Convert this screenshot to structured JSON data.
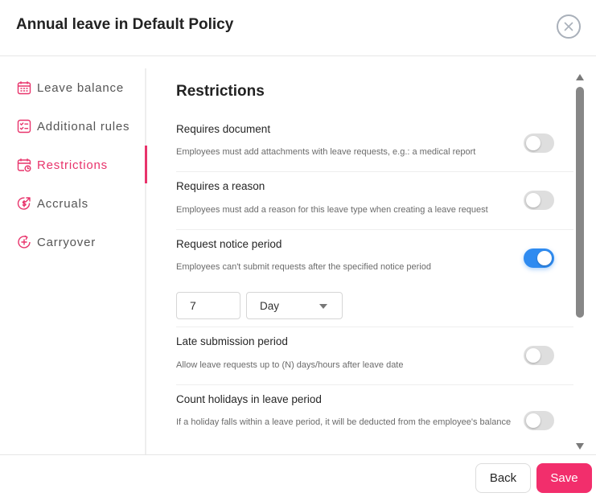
{
  "header": {
    "title": "Annual leave in Default Policy",
    "close_icon": "close-icon"
  },
  "sidebar": {
    "items": [
      {
        "label": "Leave balance",
        "icon": "calendar-grid-icon",
        "active": false
      },
      {
        "label": "Additional rules",
        "icon": "checklist-icon",
        "active": false
      },
      {
        "label": "Restrictions",
        "icon": "calendar-clock-icon",
        "active": true
      },
      {
        "label": "Accruals",
        "icon": "coin-arrow-icon",
        "active": false
      },
      {
        "label": "Carryover",
        "icon": "circular-plus-arrow-icon",
        "active": false
      }
    ],
    "accent_color": "#e8336b",
    "inactive_color": "#555555"
  },
  "main": {
    "section_title": "Restrictions",
    "rows": [
      {
        "title": "Requires document",
        "description": "Employees must add attachments with leave requests, e.g.: a medical report",
        "enabled": false
      },
      {
        "title": "Requires a reason",
        "description": "Employees must add a reason for this leave type when creating a leave request",
        "enabled": false
      },
      {
        "title": "Request notice period",
        "description": "Employees can't submit requests after the specified notice period",
        "enabled": true
      },
      {
        "title": "Late submission period",
        "description": "Allow leave requests up to (N) days/hours after leave date",
        "enabled": false
      },
      {
        "title": "Count holidays in leave period",
        "description": "If a holiday falls within a leave period, it will be deducted from the employee's balance",
        "enabled": false
      }
    ],
    "notice_period": {
      "value": "7",
      "unit": "Day"
    },
    "toggle_on_color": "#2f8bf0",
    "toggle_off_color": "#dedede"
  },
  "footer": {
    "back_label": "Back",
    "save_label": "Save",
    "save_color": "#f22e6c"
  }
}
